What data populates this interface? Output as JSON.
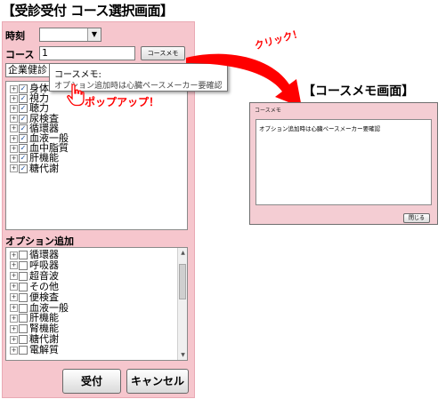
{
  "header": {
    "title": "【受診受付 コース選択画面】"
  },
  "form": {
    "time_label": "時刻",
    "time_value": "",
    "course_label": "コース",
    "course_value": "1",
    "memo_button_label": "コースメモ",
    "company_value": "企業健診"
  },
  "course_items": [
    {
      "label": "身体",
      "checked": true
    },
    {
      "label": "視力",
      "checked": true
    },
    {
      "label": "聴力",
      "checked": true
    },
    {
      "label": "尿検査",
      "checked": true
    },
    {
      "label": "循環器",
      "checked": true
    },
    {
      "label": "血液一般",
      "checked": true
    },
    {
      "label": "血中脂質",
      "checked": true
    },
    {
      "label": "肝機能",
      "checked": true
    },
    {
      "label": "糖代謝",
      "checked": true
    }
  ],
  "option": {
    "label": "オプション追加",
    "items": [
      {
        "label": "循環器",
        "checked": false
      },
      {
        "label": "呼吸器",
        "checked": false
      },
      {
        "label": "超音波",
        "checked": false
      },
      {
        "label": "その他",
        "checked": false
      },
      {
        "label": "便検査",
        "checked": false
      },
      {
        "label": "血液一般",
        "checked": false
      },
      {
        "label": "肝機能",
        "checked": false
      },
      {
        "label": "腎機能",
        "checked": false
      },
      {
        "label": "糖代謝",
        "checked": false
      },
      {
        "label": "電解質",
        "checked": false
      }
    ]
  },
  "buttons": {
    "accept": "受付",
    "cancel": "キャンセル"
  },
  "tooltip": {
    "title": "コースメモ:",
    "text": "オプション追加時は心臓ペースメーカー要確認"
  },
  "annotations": {
    "click": "クリック！",
    "popup": "ポップアップ！",
    "arrow_color": "#ff0000"
  },
  "memo_dialog": {
    "heading": "【コースメモ画面】",
    "title": "コースメモ",
    "text": "オプション追加時は心臓ペースメーカー要確認",
    "close_label": "閉じる"
  }
}
